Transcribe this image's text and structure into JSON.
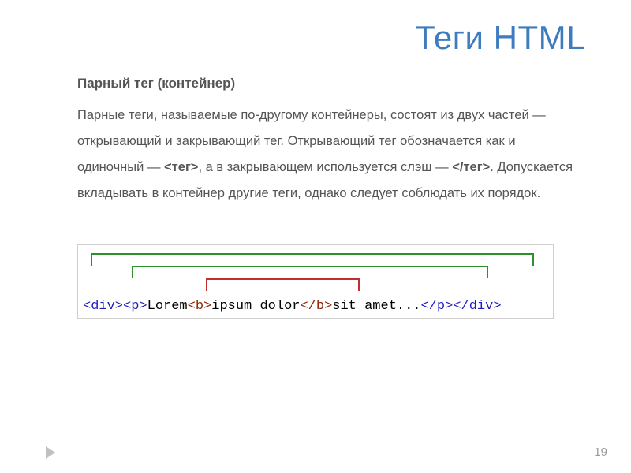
{
  "title": "Теги HTML",
  "subtitle": "Парный тег (контейнер)",
  "body": {
    "p1a": "Парные теги, называемые по-другому контейнеры, состоят из двух частей — открывающий и закрывающий тег. Открывающий тег обозначается как и одиночный — ",
    "tag_open": "<тег>",
    "p1b": ", а в закрывающем используется слэш — ",
    "tag_close": "</тег>",
    "p1c": ". Допускается вкладывать в контейнер другие теги, однако следует соблюдать их порядок."
  },
  "code": {
    "div_open": "<div>",
    "p_open": "<p>",
    "t1": "Lorem ",
    "b_open": "<b>",
    "t2": "ipsum dolor",
    "b_close": "</b>",
    "t3": " sit amet...",
    "p_close": "</p>",
    "div_close": "</div>"
  },
  "page_number": "19"
}
